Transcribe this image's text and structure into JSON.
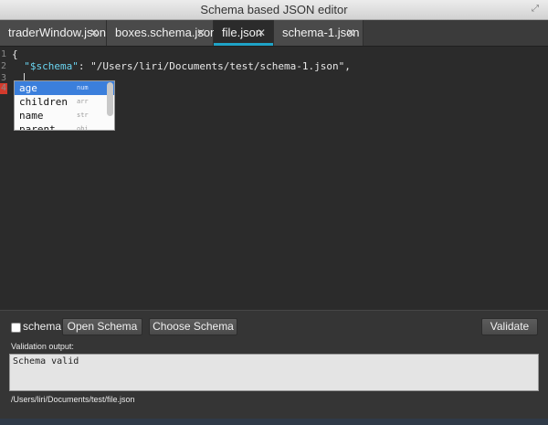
{
  "window": {
    "title": "Schema based JSON editor"
  },
  "tabs": [
    {
      "label": "traderWindow.json",
      "active": false
    },
    {
      "label": "boxes.schema.json",
      "active": false
    },
    {
      "label": "file.json",
      "active": true
    },
    {
      "label": "schema-1.json",
      "active": false
    }
  ],
  "editor": {
    "line_numbers": [
      "1",
      "2",
      "3",
      "4"
    ],
    "lines": {
      "l1": "{",
      "l2_key": "\"$schema\"",
      "l2_sep": ": ",
      "l2_value": "\"/Users/liri/Documents/test/schema-1.json\"",
      "l2_end": ","
    }
  },
  "autocomplete": {
    "items": [
      {
        "label": "age",
        "type": "num",
        "selected": true
      },
      {
        "label": "children",
        "type": "arr",
        "selected": false
      },
      {
        "label": "name",
        "type": "str",
        "selected": false
      },
      {
        "label": "parent",
        "type": "obj",
        "selected": false
      }
    ]
  },
  "panel": {
    "schema_checkbox_label": "schema",
    "schema_checked": false,
    "open_schema_label": "Open Schema",
    "choose_schema_label": "Choose Schema",
    "validate_label": "Validate",
    "validation_label": "Validation output:",
    "validation_output": "Schema valid",
    "file_path": "/Users/liri/Documents/test/file.json"
  },
  "colors": {
    "tab_accent": "#1fa3c7",
    "selection": "#3b7fdc",
    "error_marker": "#d33a2c",
    "json_key": "#6ad4f0"
  }
}
